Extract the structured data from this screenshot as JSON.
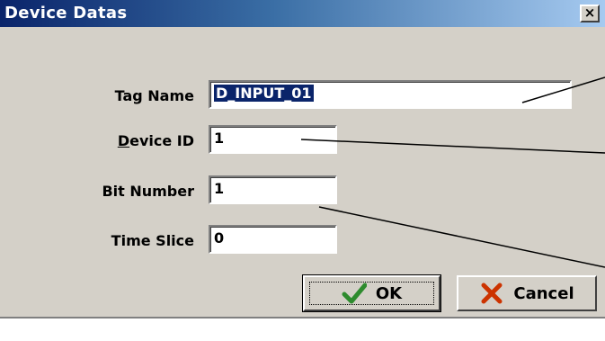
{
  "window": {
    "title": "Device Datas",
    "close_label": "×"
  },
  "fields": [
    {
      "label": "Tag Name",
      "value": "D_INPUT_01",
      "selected": true
    },
    {
      "label_prefix": "",
      "label_accel": "D",
      "label_rest": "evice ID",
      "value": "1"
    },
    {
      "label": "Bit Number",
      "value": "1"
    },
    {
      "label": "Time Slice",
      "value": "0"
    }
  ],
  "buttons": {
    "ok": {
      "label": "OK",
      "icon": "check-icon",
      "color": "#2e8b2e"
    },
    "cancel": {
      "label": "Cancel",
      "icon": "x-icon",
      "color": "#cc3300"
    }
  },
  "colors": {
    "title_start": "#0a246a",
    "title_end": "#a6caf0",
    "face": "#d4d0c8",
    "selection": "#0a246a"
  }
}
